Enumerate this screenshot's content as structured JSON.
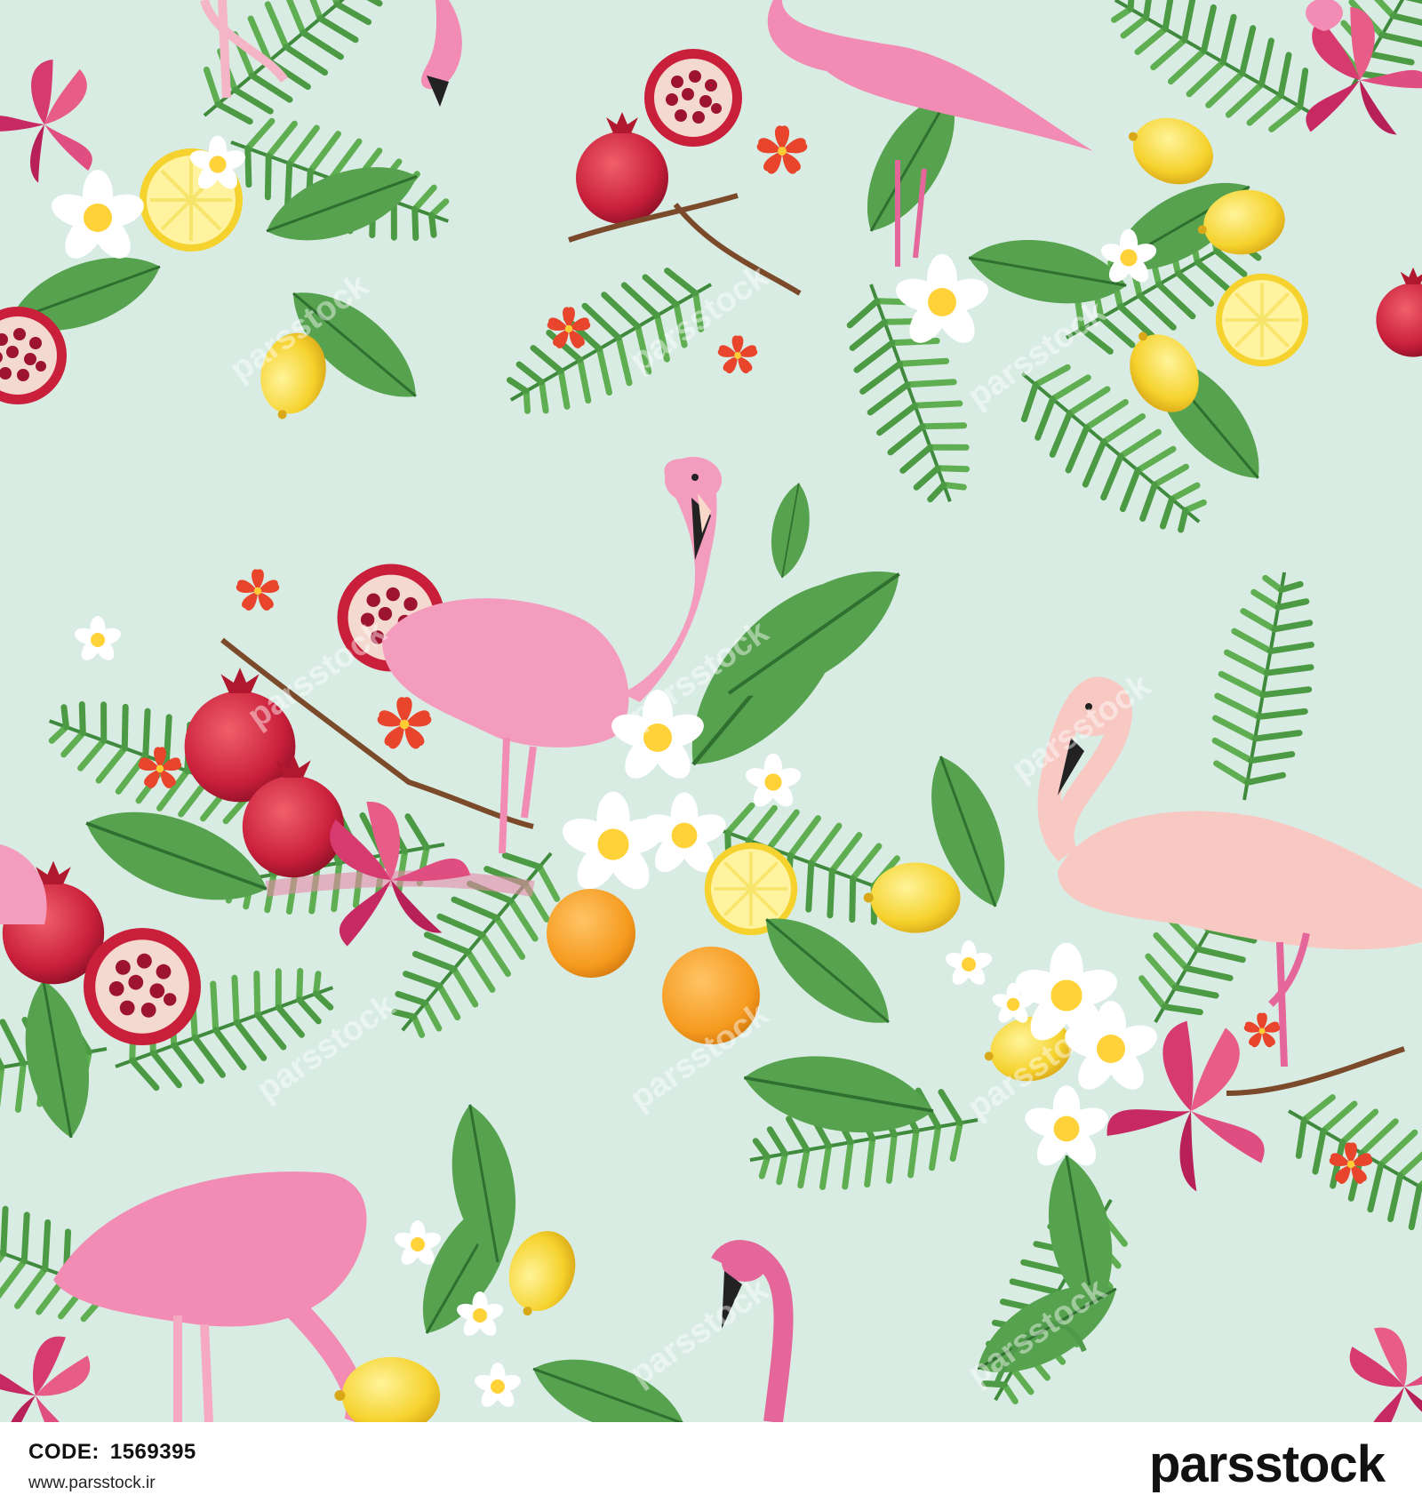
{
  "footer": {
    "code_label": "CODE:",
    "code_value": "1569395",
    "url": "www.parsstock.ir",
    "brand": "parsstock"
  },
  "watermark": {
    "text": "parsstock"
  },
  "colors": {
    "background": "#d9ece4",
    "flamingo": "#f28cb4",
    "lemon": "#f7d83a",
    "pomegranate": "#c91f3b",
    "leaf": "#4f9a4a",
    "footer_bg": "#ffffff"
  }
}
